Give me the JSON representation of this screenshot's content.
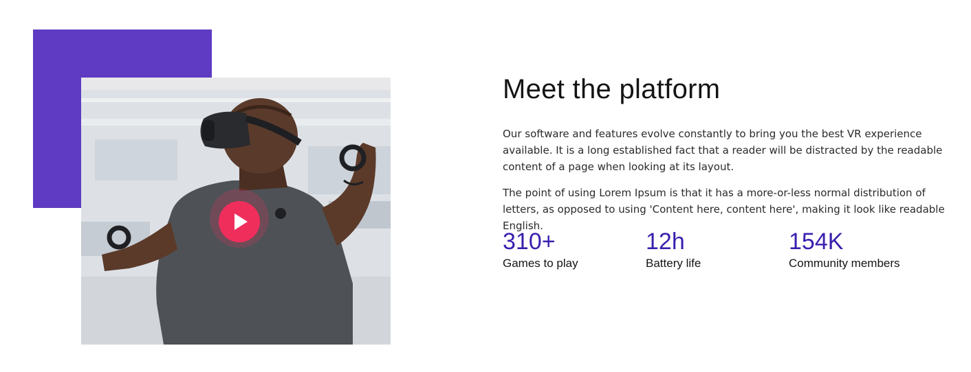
{
  "section": {
    "title": "Meet the platform",
    "paragraphs": [
      "Our software and features evolve constantly to bring you the best VR experience available. It is a long established fact that a reader will be distracted by the readable content of a page when looking at its layout.",
      "The point of using Lorem Ipsum is that it has a more-or-less normal distribution of letters, as opposed to using 'Content here, content here', making it look like readable English."
    ]
  },
  "media": {
    "play_icon": "play-icon",
    "colors": {
      "accent_block": "#5e3bc2",
      "play_button": "#ef2e5c"
    }
  },
  "stats": [
    {
      "value": "310+",
      "label": "Games to play"
    },
    {
      "value": "12h",
      "label": "Battery life"
    },
    {
      "value": "154K",
      "label": "Community members"
    }
  ],
  "colors": {
    "stat_value": "#3a1fae",
    "text": "#141414"
  }
}
